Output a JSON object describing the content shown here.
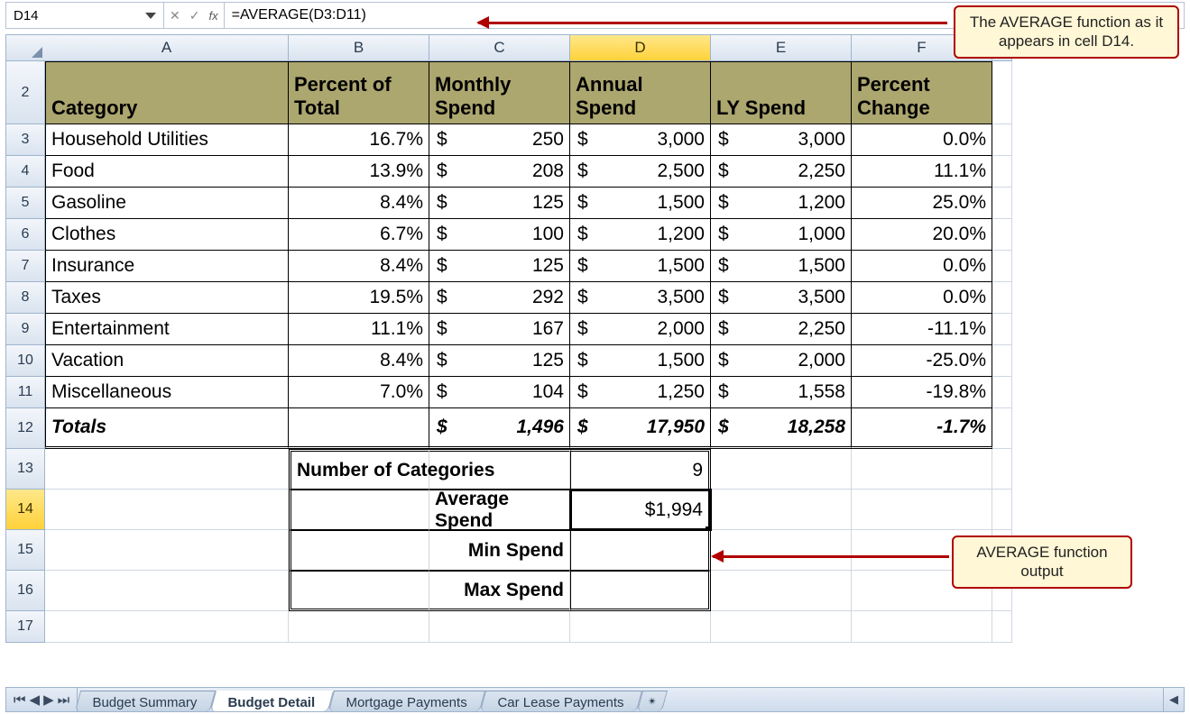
{
  "name_box": "D14",
  "formula": "=AVERAGE(D3:D11)",
  "columns": [
    "A",
    "B",
    "C",
    "D",
    "E",
    "F"
  ],
  "selected_column": "D",
  "selected_row": 14,
  "headers": {
    "category": "Category",
    "percent_of_total": "Percent of Total",
    "monthly_spend": "Monthly Spend",
    "annual_spend": "Annual Spend",
    "ly_spend": "LY Spend",
    "percent_change": "Percent Change"
  },
  "rows": [
    {
      "n": 3,
      "cat": "Household Utilities",
      "pct": "16.7%",
      "mon": "250",
      "ann": "3,000",
      "ly": "3,000",
      "chg": "0.0%"
    },
    {
      "n": 4,
      "cat": "Food",
      "pct": "13.9%",
      "mon": "208",
      "ann": "2,500",
      "ly": "2,250",
      "chg": "11.1%"
    },
    {
      "n": 5,
      "cat": "Gasoline",
      "pct": "8.4%",
      "mon": "125",
      "ann": "1,500",
      "ly": "1,200",
      "chg": "25.0%"
    },
    {
      "n": 6,
      "cat": "Clothes",
      "pct": "6.7%",
      "mon": "100",
      "ann": "1,200",
      "ly": "1,000",
      "chg": "20.0%"
    },
    {
      "n": 7,
      "cat": "Insurance",
      "pct": "8.4%",
      "mon": "125",
      "ann": "1,500",
      "ly": "1,500",
      "chg": "0.0%"
    },
    {
      "n": 8,
      "cat": "Taxes",
      "pct": "19.5%",
      "mon": "292",
      "ann": "3,500",
      "ly": "3,500",
      "chg": "0.0%"
    },
    {
      "n": 9,
      "cat": "Entertainment",
      "pct": "11.1%",
      "mon": "167",
      "ann": "2,000",
      "ly": "2,250",
      "chg": "-11.1%"
    },
    {
      "n": 10,
      "cat": "Vacation",
      "pct": "8.4%",
      "mon": "125",
      "ann": "1,500",
      "ly": "2,000",
      "chg": "-25.0%"
    },
    {
      "n": 11,
      "cat": "Miscellaneous",
      "pct": "7.0%",
      "mon": "104",
      "ann": "1,250",
      "ly": "1,558",
      "chg": "-19.8%"
    }
  ],
  "totals": {
    "label": "Totals",
    "mon": "1,496",
    "ann": "17,950",
    "ly": "18,258",
    "chg": "-1.7%"
  },
  "summary": {
    "num_cat_label": "Number of Categories",
    "num_cat_val": "9",
    "avg_label": "Average Spend",
    "avg_val": "1,994",
    "min_label": "Min Spend",
    "min_val": "",
    "max_label": "Max Spend",
    "max_val": ""
  },
  "currency": "$",
  "tabs": {
    "budget_summary": "Budget Summary",
    "budget_detail": "Budget Detail",
    "mortgage": "Mortgage Payments",
    "car_lease": "Car Lease Payments"
  },
  "callouts": {
    "top": "The AVERAGE function as it appears in cell D14.",
    "mid": "AVERAGE function output"
  },
  "chart_data": {
    "type": "table",
    "title": "Budget Detail",
    "columns": [
      "Category",
      "Percent of Total",
      "Monthly Spend",
      "Annual Spend",
      "LY Spend",
      "Percent Change"
    ],
    "rows": [
      [
        "Household Utilities",
        0.167,
        250,
        3000,
        3000,
        0.0
      ],
      [
        "Food",
        0.139,
        208,
        2500,
        2250,
        0.111
      ],
      [
        "Gasoline",
        0.084,
        125,
        1500,
        1200,
        0.25
      ],
      [
        "Clothes",
        0.067,
        100,
        1200,
        1000,
        0.2
      ],
      [
        "Insurance",
        0.084,
        125,
        1500,
        1500,
        0.0
      ],
      [
        "Taxes",
        0.195,
        292,
        3500,
        3500,
        0.0
      ],
      [
        "Entertainment",
        0.111,
        167,
        2000,
        2250,
        -0.111
      ],
      [
        "Vacation",
        0.084,
        125,
        1500,
        2000,
        -0.25
      ],
      [
        "Miscellaneous",
        0.07,
        104,
        1250,
        1558,
        -0.198
      ]
    ],
    "totals": {
      "Monthly Spend": 1496,
      "Annual Spend": 17950,
      "LY Spend": 18258,
      "Percent Change": -0.017
    },
    "summary": {
      "Number of Categories": 9,
      "Average Spend": 1994
    }
  }
}
